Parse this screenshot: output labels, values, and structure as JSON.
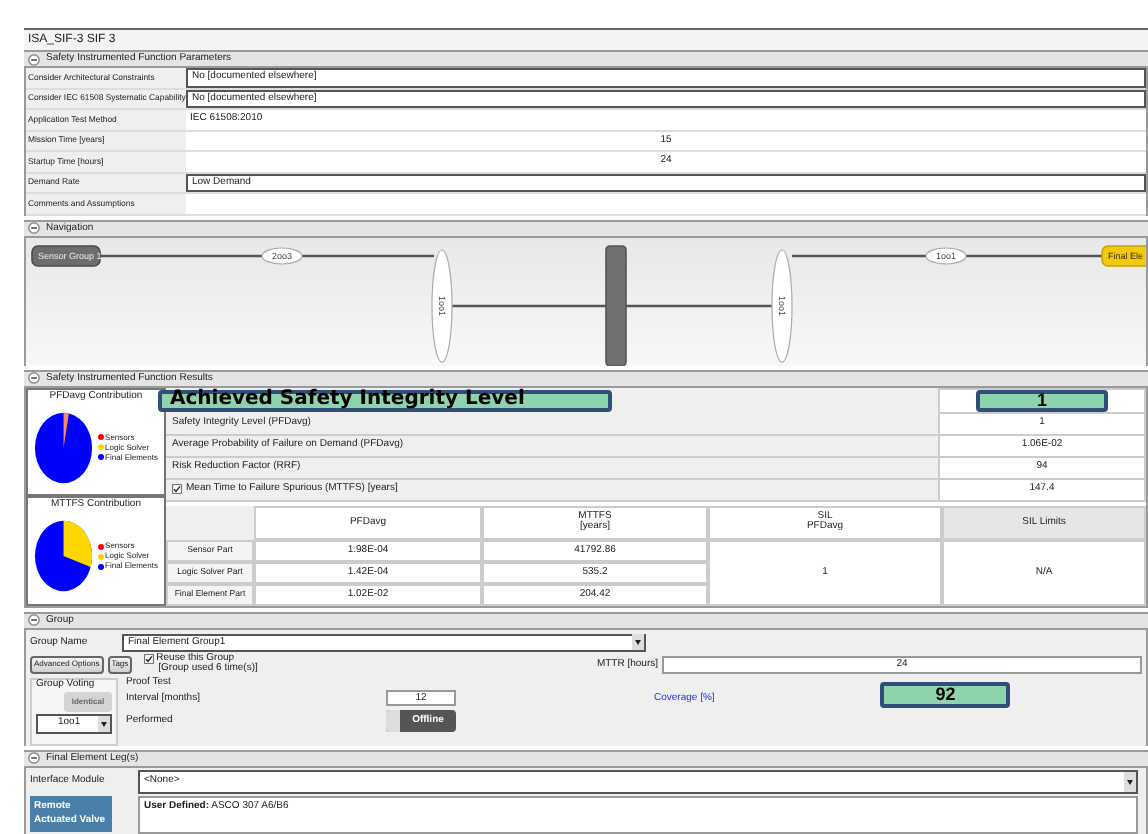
{
  "window": {
    "title": "ISA_SIF-3 SIF 3"
  },
  "parameters": {
    "title": "Safety Instrumented Function Parameters",
    "expanded": true,
    "rows": [
      {
        "label": "Consider Architectural Constraints",
        "value": "No [documented elsewhere]",
        "kind": "dropdown"
      },
      {
        "label": "Consider IEC 61508 Systematic Capability",
        "value": "No [documented elsewhere]",
        "kind": "dropdown"
      },
      {
        "label": "Application Test Method",
        "value": "IEC 61508:2010",
        "kind": "text"
      },
      {
        "label": "Mission Time [years]",
        "value": "15",
        "kind": "number"
      },
      {
        "label": "Startup Time [hours]",
        "value": "24",
        "kind": "number"
      },
      {
        "label": "Demand Rate",
        "value": "Low Demand",
        "kind": "dropdown"
      },
      {
        "label": "Comments and Assumptions",
        "kind": "text"
      }
    ]
  },
  "navigation": {
    "title": "Navigation",
    "expanded": true,
    "nodes": [
      {
        "kind": "group",
        "label": "Sensor Group 1",
        "selected": false
      },
      {
        "kind": "voting",
        "label": "2oo3"
      },
      {
        "kind": "vertical-voting",
        "label": "1oo1"
      },
      {
        "kind": "bar"
      },
      {
        "kind": "vertical-voting",
        "label": "1oo1"
      },
      {
        "kind": "voting",
        "label": "1oo1"
      },
      {
        "kind": "group",
        "label": "Final Ele",
        "selected": true
      }
    ]
  },
  "results": {
    "title": "Safety Instrumented Function Results",
    "expanded": true,
    "pfd_contribution": {
      "title": "PFDavg Contribution",
      "legend": [
        {
          "label": "Sensors",
          "color": "#ff0000"
        },
        {
          "label": "Logic Solver",
          "color": "#ffd700"
        },
        {
          "label": "Final Elements",
          "color": "#0000ff"
        }
      ]
    },
    "mttfs_contribution": {
      "title": "MTTFS Contribution",
      "legend": [
        {
          "label": "Sensors",
          "color": "#ff0000"
        },
        {
          "label": "Logic Solver",
          "color": "#ffd700"
        },
        {
          "label": "Final Elements",
          "color": "#0000ff"
        }
      ]
    },
    "achieved_sil": {
      "label": "Achieved Safety Integrity Level",
      "value": "1"
    },
    "metrics": [
      {
        "label": "Safety Integrity Level (PFDavg)",
        "value": "1",
        "kind": "plain"
      },
      {
        "label": "Average Probability of Failure on Demand (PFDavg)",
        "value": "1.06E-02",
        "kind": "plain"
      },
      {
        "label": "Risk Reduction Factor (RRF)",
        "value": "94",
        "kind": "plain"
      },
      {
        "label": "Mean Time to Failure Spurious (MTTFS) [years]",
        "value": "147.4",
        "kind": "checkbox",
        "checked": true
      }
    ],
    "table": {
      "columns": [
        "PFDavg",
        "MTTFS\n[years]",
        "SIL\nPFDavg",
        "SIL Limits"
      ],
      "rows": [
        {
          "label": "Sensor Part",
          "pfdavg": "1.98E-04",
          "mttfs": "41792.86"
        },
        {
          "label": "Logic Solver Part",
          "pfdavg": "1.42E-04",
          "mttfs": "535.2"
        },
        {
          "label": "Final Element Part",
          "pfdavg": "1.02E-02",
          "mttfs": "204.42"
        }
      ],
      "sil": "1",
      "sil_limits": "N/A"
    }
  },
  "group": {
    "title": "Group",
    "expanded": true,
    "name_label": "Group Name",
    "name": "Final Element Group1",
    "buttons": [
      "Advanced Options",
      "Tags"
    ],
    "reuse": {
      "label": "Reuse this Group",
      "note": "[Group used 6 time(s)]",
      "checked": true
    },
    "mttr": {
      "label": "MTTR",
      "unit": "[hours]",
      "value": "24"
    },
    "voting": {
      "title": "Group Voting",
      "identical": {
        "label": "Identical",
        "disabled": true
      },
      "value": "1oo1"
    },
    "proof_test": {
      "title": "Proof Test",
      "interval_label": "Interval",
      "interval_unit": "[months]",
      "interval": "12",
      "performed_label": "Performed",
      "performed": "Offline",
      "coverage_label": "Coverage [%]",
      "coverage": "92"
    }
  },
  "legs": {
    "title": "Final Element Leg(s)",
    "expanded": true,
    "interface_label": "Interface Module",
    "interface": "<None>",
    "items": [
      {
        "label": "Remote Actuated Valve",
        "selected": true
      }
    ],
    "detail": "**User Defined:** ASCO 307 A6/B6"
  }
}
